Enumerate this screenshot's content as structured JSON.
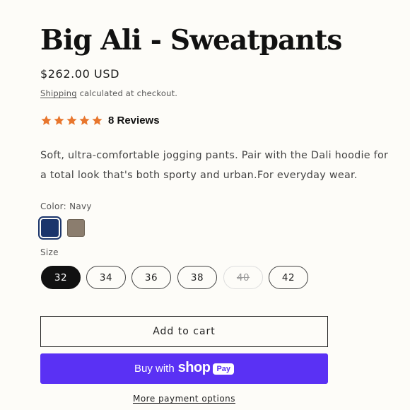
{
  "product": {
    "title": "Big Ali - Sweatpants",
    "price": "$262.00 USD",
    "shipping_link": "Shipping",
    "shipping_suffix": " calculated at checkout."
  },
  "reviews": {
    "rating": 5,
    "max": 5,
    "label": "8 Reviews",
    "star_color": "#e8762d"
  },
  "description": "Soft, ultra-comfortable jogging pants. Pair with the Dali hoodie for a total look that's both sporty and urban.For everyday wear.",
  "color": {
    "label": "Color: Navy",
    "options": [
      {
        "name": "Navy",
        "hex": "#1b356b",
        "selected": true
      },
      {
        "name": "Taupe",
        "hex": "#8b7d6e",
        "selected": false
      }
    ]
  },
  "size": {
    "label": "Size",
    "options": [
      {
        "value": "32",
        "selected": true,
        "available": true
      },
      {
        "value": "34",
        "selected": false,
        "available": true
      },
      {
        "value": "36",
        "selected": false,
        "available": true
      },
      {
        "value": "38",
        "selected": false,
        "available": true
      },
      {
        "value": "40",
        "selected": false,
        "available": false
      },
      {
        "value": "42",
        "selected": false,
        "available": true
      }
    ]
  },
  "actions": {
    "add_to_cart": "Add to cart",
    "buy_with": "Buy with",
    "shop_word": "shop",
    "pay_badge": "Pay",
    "shop_color": "#5a31f4",
    "more_options": "More payment options"
  }
}
